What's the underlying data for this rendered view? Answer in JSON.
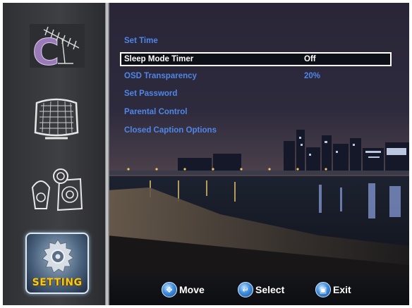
{
  "menu": {
    "items": [
      {
        "label": "Set Time",
        "value": ""
      },
      {
        "label": "Sleep Mode Timer",
        "value": "Off"
      },
      {
        "label": "OSD Transparency",
        "value": "20%"
      },
      {
        "label": "Set Password",
        "value": ""
      },
      {
        "label": "Parental Control",
        "value": ""
      },
      {
        "label": "Closed Caption Options",
        "value": ""
      }
    ],
    "selected_index": 1
  },
  "sidebar": {
    "items": [
      {
        "name": "channel",
        "icon": "antenna-icon"
      },
      {
        "name": "picture",
        "icon": "screen-icon"
      },
      {
        "name": "sound",
        "icon": "speakers-icon"
      },
      {
        "name": "setting",
        "icon": "gear-icon",
        "label": "SETTING",
        "active": true
      }
    ]
  },
  "footer": {
    "move_label": "Move",
    "select_label": "Select",
    "exit_label": "Exit"
  },
  "colors": {
    "menu_text": "#4f86e8",
    "selected_text": "#ffffff",
    "setting_label": "#f4c81e"
  }
}
